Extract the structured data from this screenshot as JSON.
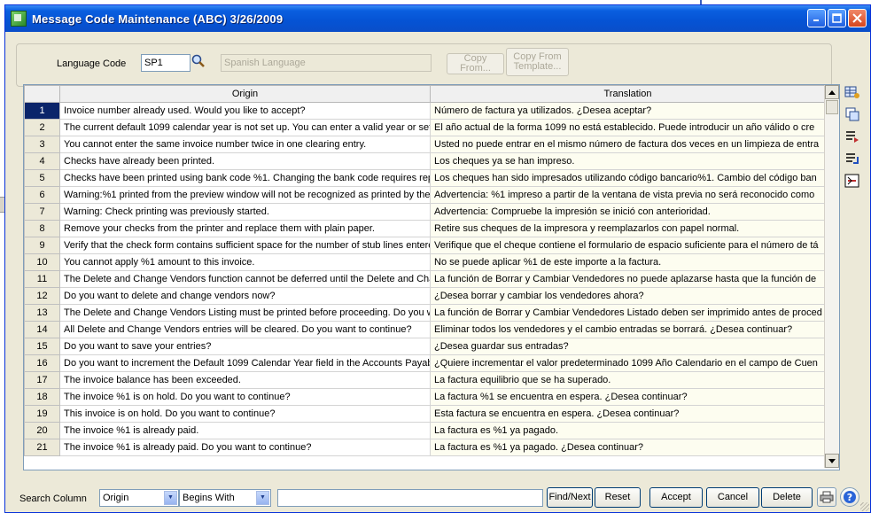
{
  "window": {
    "title": "Message Code Maintenance (ABC) 3/26/2009",
    "buttons": [
      "minimize",
      "maximize",
      "close"
    ]
  },
  "header": {
    "language_label": "Language Code",
    "language_code": "SP1",
    "language_name": "Spanish Language",
    "copy_from": "Copy From...",
    "copy_template_line1": "Copy From",
    "copy_template_line2": "Template..."
  },
  "grid": {
    "columns": [
      "Origin",
      "Translation"
    ],
    "rows": [
      {
        "num": "1",
        "origin": "Invoice number already used.  Would you like to accept?",
        "translation": "Número de factura ya utilizados. ¿Desea aceptar?"
      },
      {
        "num": "2",
        "origin": "The current default 1099 calendar year is not set up.  You can enter a valid year or set u",
        "translation": "El año actual de la forma 1099 no está establecido. Puede introducir un año válido o cre"
      },
      {
        "num": "3",
        "origin": "You cannot enter the same invoice number twice in one clearing entry.",
        "translation": "Usted no puede entrar en el mismo número de factura dos veces en un limpieza de entra"
      },
      {
        "num": "4",
        "origin": "Checks have already been printed.",
        "translation": "Los cheques ya se han impreso."
      },
      {
        "num": "5",
        "origin": "Checks have been printed using bank code %1.  Changing the bank code requires repri",
        "translation": "Los cheques han sido impresados utilizando código bancario%1. Cambio del código ban"
      },
      {
        "num": "6",
        "origin": "Warning:%1 printed from the preview window will not be recognized as printed by the sys",
        "translation": "Advertencia: %1 impreso a partir de la ventana de vista previa no será reconocido como"
      },
      {
        "num": "7",
        "origin": "Warning:  Check printing was previously started.",
        "translation": "Advertencia: Compruebe la impresión se inició con anterioridad."
      },
      {
        "num": "8",
        "origin": "Remove your checks from the printer and replace them with plain paper.",
        "translation": "Retire sus cheques de la impresora y reemplazarlos con papel normal."
      },
      {
        "num": "9",
        "origin": "Verify that the check form contains sufficient space for the number of stub lines entered.",
        "translation": "Verifique que el cheque contiene el formulario de espacio suficiente para el número de tá"
      },
      {
        "num": "10",
        "origin": "You cannot apply %1 amount to this invoice.",
        "translation": "No se puede aplicar %1 de este importe a la factura."
      },
      {
        "num": "11",
        "origin": "The Delete and Change Vendors function cannot be deferred until the Delete and Chang",
        "translation": "La función de Borrar y Cambiar Vendedores no puede aplazarse hasta que la función de"
      },
      {
        "num": "12",
        "origin": "Do you want to delete and change vendors now?",
        "translation": "¿Desea borrar y cambiar los vendedores ahora?"
      },
      {
        "num": "13",
        "origin": "The Delete and Change Vendors Listing must be printed before proceeding.  Do you war",
        "translation": "La función de Borrar y Cambiar Vendedores Listado deben ser imprimido antes de proced"
      },
      {
        "num": "14",
        "origin": "All Delete and Change Vendors entries will be cleared.  Do you want to continue?",
        "translation": "Eliminar todos los vendedores y el cambio entradas se borrará. ¿Desea continuar?"
      },
      {
        "num": "15",
        "origin": "Do you want to save your entries?",
        "translation": "¿Desea guardar sus entradas?"
      },
      {
        "num": "16",
        "origin": "Do you want to increment the Default 1099 Calendar Year field in the Accounts Payable",
        "translation": "¿Quiere incrementar el valor predeterminado 1099 Año Calendario en el campo de Cuen"
      },
      {
        "num": "17",
        "origin": "The invoice balance has been exceeded.",
        "translation": "La factura equilibrio que se ha superado."
      },
      {
        "num": "18",
        "origin": "The invoice %1 is on hold.  Do you want to continue?",
        "translation": "La factura %1 se encuentra en espera. ¿Desea continuar?"
      },
      {
        "num": "19",
        "origin": "This invoice is on hold.  Do you want to continue?",
        "translation": "Esta factura se encuentra en espera. ¿Desea continuar?"
      },
      {
        "num": "20",
        "origin": "The invoice %1 is already paid.",
        "translation": "La factura es %1 ya pagado."
      },
      {
        "num": "21",
        "origin": "The invoice %1 is already paid.  Do you want to continue?",
        "translation": "La factura es %1 ya pagado. ¿Desea continuar?"
      }
    ],
    "selected_row": "1"
  },
  "side_icons": [
    "grid-settings-icon",
    "copy-rows-icon",
    "insert-row-icon",
    "append-row-icon",
    "delete-row-icon"
  ],
  "footer": {
    "search_label": "Search Column",
    "search_column": "Origin",
    "search_mode": "Begins With",
    "search_value": "",
    "find_next": "Find/Next",
    "reset": "Reset",
    "accept": "Accept",
    "cancel": "Cancel",
    "delete": "Delete"
  }
}
